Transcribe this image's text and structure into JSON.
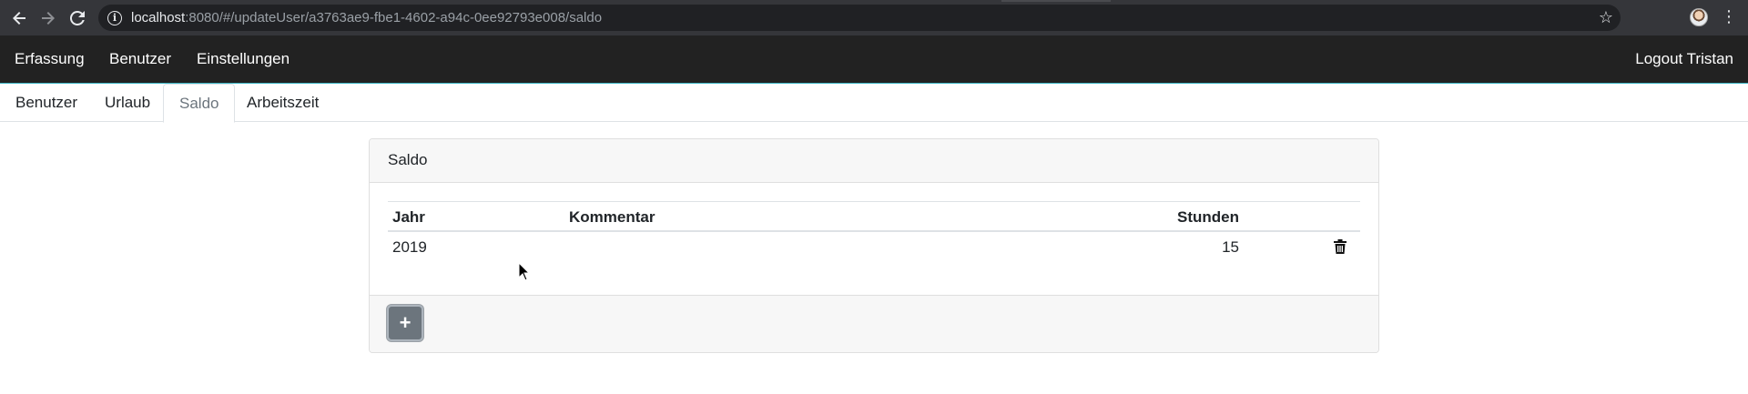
{
  "browser": {
    "url_host": "localhost",
    "url_rest": ":8080/#/updateUser/a3763ae9-fbe1-4602-a94c-0ee92793e008/saldo",
    "icons": [
      "back-arrow-icon",
      "forward-arrow-icon",
      "reload-icon",
      "info-icon",
      "star-icon",
      "profile-avatar",
      "menu-dots-icon"
    ]
  },
  "navbar": {
    "items": [
      {
        "label": "Erfassung"
      },
      {
        "label": "Benutzer"
      },
      {
        "label": "Einstellungen"
      }
    ],
    "logout_label": "Logout Tristan",
    "background": "#222222"
  },
  "subtabs": {
    "items": [
      {
        "label": "Benutzer"
      },
      {
        "label": "Urlaub"
      },
      {
        "label": "Saldo"
      },
      {
        "label": "Arbeitszeit"
      }
    ],
    "active": "Saldo"
  },
  "card": {
    "title": "Saldo",
    "table": {
      "headers": {
        "jahr": "Jahr",
        "kommentar": "Kommentar",
        "stunden": "Stunden"
      },
      "rows": [
        {
          "jahr": "2019",
          "kommentar": "",
          "stunden": "15"
        }
      ]
    },
    "add_button_label": "+",
    "add_button_color": "#6c757d"
  }
}
